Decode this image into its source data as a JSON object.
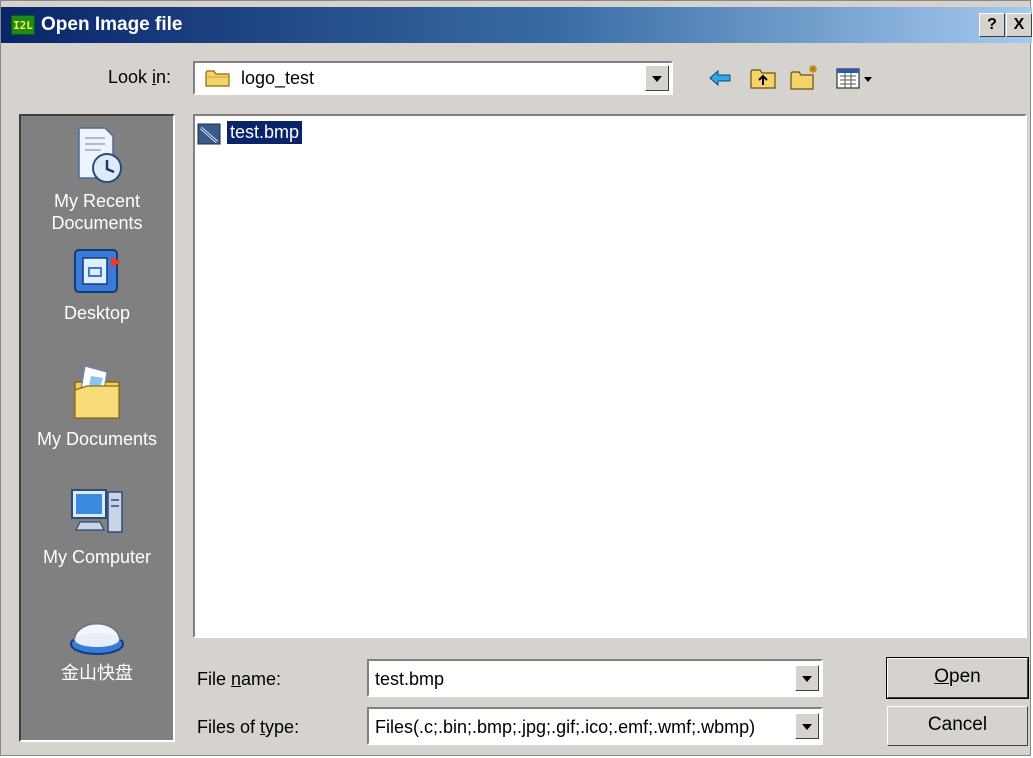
{
  "window": {
    "title": "Open Image file",
    "app_icon_text": "I2L",
    "help_label": "?",
    "close_label": "X"
  },
  "lookin": {
    "label_prefix": "Look ",
    "label_accel": "i",
    "label_suffix": "n:",
    "value": "logo_test"
  },
  "toolbar": {
    "icons": [
      "back-icon",
      "up-folder-icon",
      "new-folder-icon",
      "view-menu-icon"
    ]
  },
  "places": [
    {
      "line1": "My Recent",
      "line2": "Documents",
      "icon": "recent-documents-icon"
    },
    {
      "line1": "Desktop",
      "line2": "",
      "icon": "desktop-icon"
    },
    {
      "line1": "My Documents",
      "line2": "",
      "icon": "my-documents-icon"
    },
    {
      "line1": "My Computer",
      "line2": "",
      "icon": "my-computer-icon"
    },
    {
      "line1": "金山快盘",
      "line2": "",
      "icon": "drive-icon"
    }
  ],
  "files": [
    {
      "name": "test.bmp",
      "selected": true
    }
  ],
  "filename": {
    "label_prefix": "File ",
    "label_accel": "n",
    "label_suffix": "ame:",
    "value": "test.bmp"
  },
  "filetype": {
    "label_prefix": "Files of ",
    "label_accel": "t",
    "label_suffix": "ype:",
    "value": "Files(.c;.bin;.bmp;.jpg;.gif;.ico;.emf;.wmf;.wbmp)"
  },
  "buttons": {
    "open_accel": "O",
    "open_rest": "pen",
    "cancel": "Cancel"
  },
  "colors": {
    "title_bar_start": "#0a246a",
    "title_bar_end": "#a6caf0",
    "places_bg": "#808080",
    "selection": "#0a246a"
  }
}
